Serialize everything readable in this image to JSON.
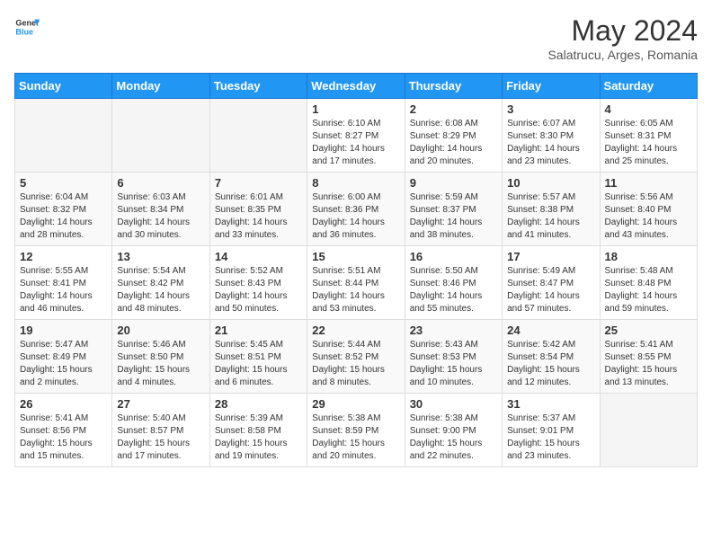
{
  "header": {
    "logo_line1": "General",
    "logo_line2": "Blue",
    "month_year": "May 2024",
    "location": "Salatrucu, Arges, Romania"
  },
  "weekdays": [
    "Sunday",
    "Monday",
    "Tuesday",
    "Wednesday",
    "Thursday",
    "Friday",
    "Saturday"
  ],
  "weeks": [
    [
      {
        "day": "",
        "info": ""
      },
      {
        "day": "",
        "info": ""
      },
      {
        "day": "",
        "info": ""
      },
      {
        "day": "1",
        "info": "Sunrise: 6:10 AM\nSunset: 8:27 PM\nDaylight: 14 hours and 17 minutes."
      },
      {
        "day": "2",
        "info": "Sunrise: 6:08 AM\nSunset: 8:29 PM\nDaylight: 14 hours and 20 minutes."
      },
      {
        "day": "3",
        "info": "Sunrise: 6:07 AM\nSunset: 8:30 PM\nDaylight: 14 hours and 23 minutes."
      },
      {
        "day": "4",
        "info": "Sunrise: 6:05 AM\nSunset: 8:31 PM\nDaylight: 14 hours and 25 minutes."
      }
    ],
    [
      {
        "day": "5",
        "info": "Sunrise: 6:04 AM\nSunset: 8:32 PM\nDaylight: 14 hours and 28 minutes."
      },
      {
        "day": "6",
        "info": "Sunrise: 6:03 AM\nSunset: 8:34 PM\nDaylight: 14 hours and 30 minutes."
      },
      {
        "day": "7",
        "info": "Sunrise: 6:01 AM\nSunset: 8:35 PM\nDaylight: 14 hours and 33 minutes."
      },
      {
        "day": "8",
        "info": "Sunrise: 6:00 AM\nSunset: 8:36 PM\nDaylight: 14 hours and 36 minutes."
      },
      {
        "day": "9",
        "info": "Sunrise: 5:59 AM\nSunset: 8:37 PM\nDaylight: 14 hours and 38 minutes."
      },
      {
        "day": "10",
        "info": "Sunrise: 5:57 AM\nSunset: 8:38 PM\nDaylight: 14 hours and 41 minutes."
      },
      {
        "day": "11",
        "info": "Sunrise: 5:56 AM\nSunset: 8:40 PM\nDaylight: 14 hours and 43 minutes."
      }
    ],
    [
      {
        "day": "12",
        "info": "Sunrise: 5:55 AM\nSunset: 8:41 PM\nDaylight: 14 hours and 46 minutes."
      },
      {
        "day": "13",
        "info": "Sunrise: 5:54 AM\nSunset: 8:42 PM\nDaylight: 14 hours and 48 minutes."
      },
      {
        "day": "14",
        "info": "Sunrise: 5:52 AM\nSunset: 8:43 PM\nDaylight: 14 hours and 50 minutes."
      },
      {
        "day": "15",
        "info": "Sunrise: 5:51 AM\nSunset: 8:44 PM\nDaylight: 14 hours and 53 minutes."
      },
      {
        "day": "16",
        "info": "Sunrise: 5:50 AM\nSunset: 8:46 PM\nDaylight: 14 hours and 55 minutes."
      },
      {
        "day": "17",
        "info": "Sunrise: 5:49 AM\nSunset: 8:47 PM\nDaylight: 14 hours and 57 minutes."
      },
      {
        "day": "18",
        "info": "Sunrise: 5:48 AM\nSunset: 8:48 PM\nDaylight: 14 hours and 59 minutes."
      }
    ],
    [
      {
        "day": "19",
        "info": "Sunrise: 5:47 AM\nSunset: 8:49 PM\nDaylight: 15 hours and 2 minutes."
      },
      {
        "day": "20",
        "info": "Sunrise: 5:46 AM\nSunset: 8:50 PM\nDaylight: 15 hours and 4 minutes."
      },
      {
        "day": "21",
        "info": "Sunrise: 5:45 AM\nSunset: 8:51 PM\nDaylight: 15 hours and 6 minutes."
      },
      {
        "day": "22",
        "info": "Sunrise: 5:44 AM\nSunset: 8:52 PM\nDaylight: 15 hours and 8 minutes."
      },
      {
        "day": "23",
        "info": "Sunrise: 5:43 AM\nSunset: 8:53 PM\nDaylight: 15 hours and 10 minutes."
      },
      {
        "day": "24",
        "info": "Sunrise: 5:42 AM\nSunset: 8:54 PM\nDaylight: 15 hours and 12 minutes."
      },
      {
        "day": "25",
        "info": "Sunrise: 5:41 AM\nSunset: 8:55 PM\nDaylight: 15 hours and 13 minutes."
      }
    ],
    [
      {
        "day": "26",
        "info": "Sunrise: 5:41 AM\nSunset: 8:56 PM\nDaylight: 15 hours and 15 minutes."
      },
      {
        "day": "27",
        "info": "Sunrise: 5:40 AM\nSunset: 8:57 PM\nDaylight: 15 hours and 17 minutes."
      },
      {
        "day": "28",
        "info": "Sunrise: 5:39 AM\nSunset: 8:58 PM\nDaylight: 15 hours and 19 minutes."
      },
      {
        "day": "29",
        "info": "Sunrise: 5:38 AM\nSunset: 8:59 PM\nDaylight: 15 hours and 20 minutes."
      },
      {
        "day": "30",
        "info": "Sunrise: 5:38 AM\nSunset: 9:00 PM\nDaylight: 15 hours and 22 minutes."
      },
      {
        "day": "31",
        "info": "Sunrise: 5:37 AM\nSunset: 9:01 PM\nDaylight: 15 hours and 23 minutes."
      },
      {
        "day": "",
        "info": ""
      }
    ]
  ]
}
